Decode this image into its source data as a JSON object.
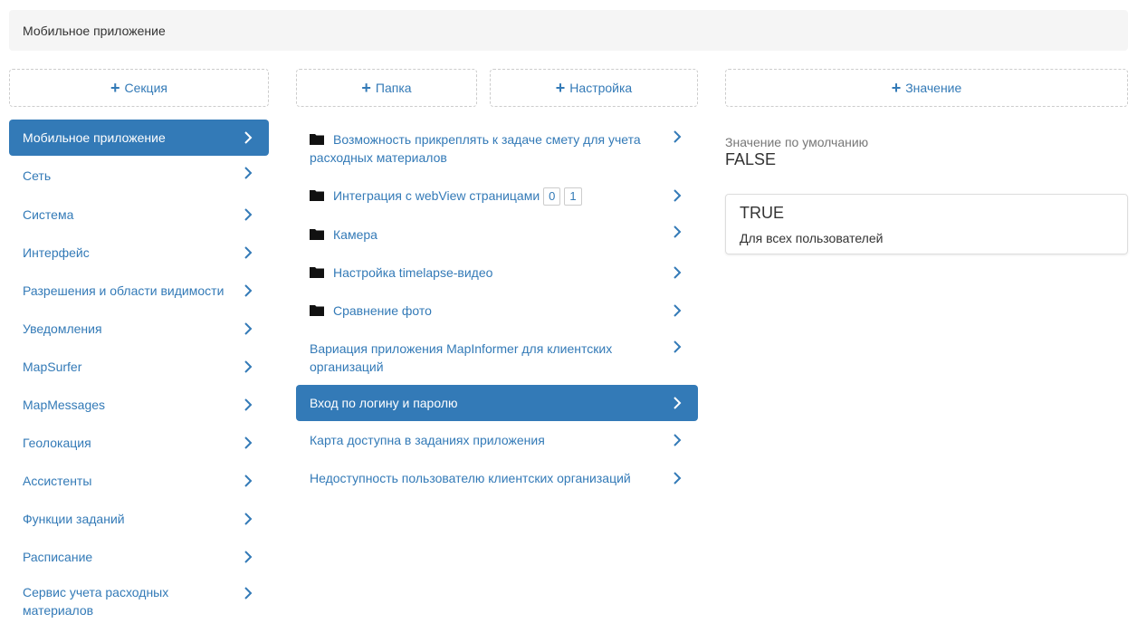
{
  "breadcrumb": {
    "title": "Мобильное приложение"
  },
  "buttons": {
    "section": "Секция",
    "folder": "Папка",
    "setting": "Настройка",
    "value": "Значение"
  },
  "sections": [
    {
      "label": "Мобильное приложение",
      "active": true
    },
    {
      "label": "Сеть"
    },
    {
      "label": "Система"
    },
    {
      "label": "Интерфейс"
    },
    {
      "label": "Разрешения и области видимости"
    },
    {
      "label": "Уведомления"
    },
    {
      "label": "MapSurfer"
    },
    {
      "label": "MapMessages"
    },
    {
      "label": "Геолокация"
    },
    {
      "label": "Ассистенты"
    },
    {
      "label": "Функции заданий"
    },
    {
      "label": "Расписание"
    },
    {
      "label": "Сервис учета расходных материалов"
    }
  ],
  "settings": [
    {
      "label": "Возможность прикреплять к задаче смету для учета расходных материалов",
      "folder": true
    },
    {
      "label": "Интеграция с webView страницами",
      "folder": true,
      "badges": [
        "0",
        "1"
      ]
    },
    {
      "label": "Камера",
      "folder": true
    },
    {
      "label": "Настройка timelapse-видео",
      "folder": true
    },
    {
      "label": "Сравнение фото",
      "folder": true
    },
    {
      "label": "Вариация приложения MapInformer для клиентских организаций"
    },
    {
      "label": "Вход по логину и паролю",
      "active": true
    },
    {
      "label": "Карта доступна в заданиях приложения"
    },
    {
      "label": "Недоступность пользователю клиентских организаций"
    }
  ],
  "values": {
    "default_label": "Значение по умолчанию",
    "default_value": "FALSE",
    "card": {
      "value": "TRUE",
      "scope": "Для всех пользователей"
    }
  },
  "colors": {
    "accent": "#337ab7",
    "breadcrumb_bg": "#f5f5f5"
  },
  "icons": {
    "add": "plus-icon",
    "row": "chevron-right-icon",
    "folder": "folder-icon"
  }
}
